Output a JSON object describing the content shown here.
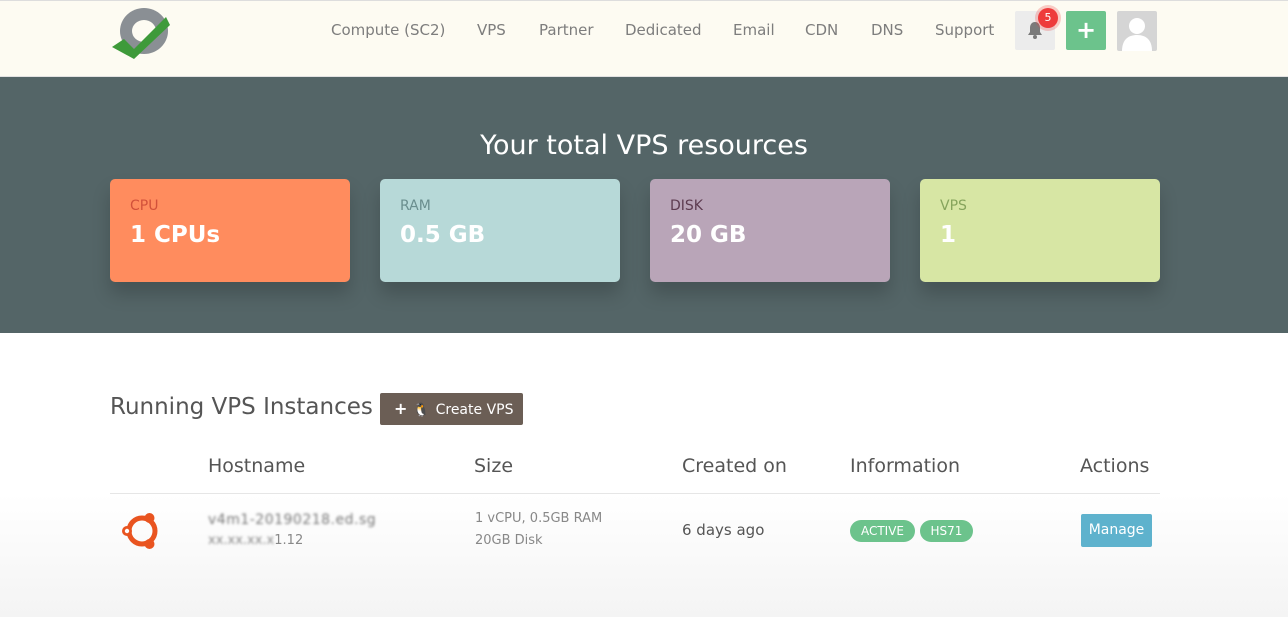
{
  "nav": {
    "items": [
      "Compute (SC2)",
      "VPS",
      "Partner",
      "Dedicated",
      "Email",
      "CDN",
      "DNS",
      "Support"
    ],
    "notification_count": "5",
    "add_label": "+"
  },
  "hero": {
    "title": "Your total VPS resources",
    "cards": [
      {
        "label": "CPU",
        "value": "1 CPUs",
        "bg": "#ff8c5e",
        "label_color": "#d2513a"
      },
      {
        "label": "RAM",
        "value": "0.5 GB",
        "bg": "#b7d9d8",
        "label_color": "#6a8e8e"
      },
      {
        "label": "DISK",
        "value": "20 GB",
        "bg": "#b9a5b8",
        "label_color": "#5d3c50"
      },
      {
        "label": "VPS",
        "value": "1",
        "bg": "#d7e6a4",
        "label_color": "#86a45c"
      }
    ]
  },
  "instances": {
    "title": "Running VPS Instances",
    "create_label": "Create VPS",
    "columns": [
      "Hostname",
      "Size",
      "Created on",
      "Information",
      "Actions"
    ],
    "rows": [
      {
        "hostname": "v4m1-20190218.ed.sg",
        "ip_prefix": "xx.xx.xx.x",
        "ip_suffix": "1.12",
        "size_line1": "1 vCPU, 0.5GB RAM",
        "size_line2": "20GB Disk",
        "created": "6 days ago",
        "status": "ACTIVE",
        "location": "HS71",
        "action": "Manage"
      }
    ]
  },
  "colors": {
    "hero_bg": "#546567",
    "accent_green": "#6cc38c",
    "manage_blue": "#5eb2cd",
    "ubuntu_orange": "#e95420"
  },
  "icons": [
    "logo-icon",
    "bell-icon",
    "plus-icon",
    "user-avatar-icon",
    "linux-icon",
    "ubuntu-icon"
  ]
}
